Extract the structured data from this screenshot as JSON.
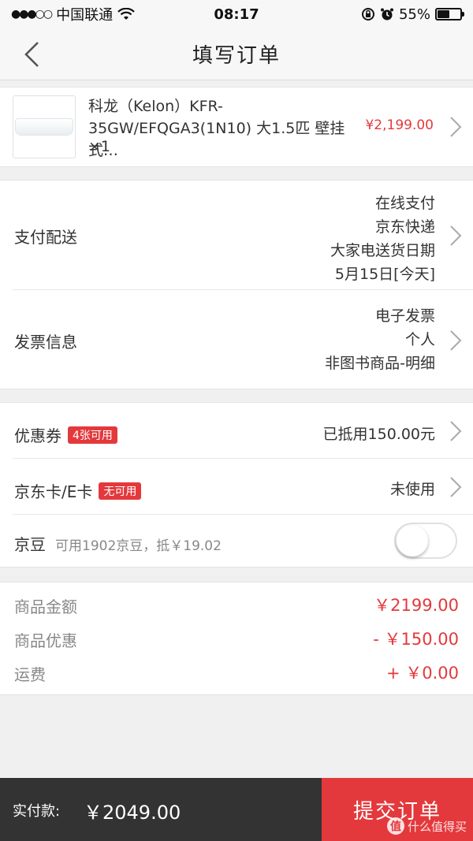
{
  "status_bar": {
    "carrier": "中国联通",
    "time": "08:17",
    "battery_percent": "55%",
    "battery_level": 0.55,
    "icons": [
      "signal-icon",
      "wifi-icon",
      "orientation-lock-icon",
      "alarm-icon",
      "battery-icon"
    ]
  },
  "nav": {
    "title": "填写订单",
    "back_icon": "chevron-left-icon"
  },
  "product": {
    "name": "科龙（Kelon）KFR-35GW/EFQGA3(1N10) 大1.5匹 壁挂式…",
    "quantity": "×1",
    "price": "¥2,199.00"
  },
  "delivery": {
    "label": "支付配送",
    "lines": [
      "在线支付",
      "京东快递",
      "大家电送货日期",
      "5月15日[今天]"
    ]
  },
  "invoice": {
    "label": "发票信息",
    "lines": [
      "电子发票",
      "个人",
      "非图书商品-明细"
    ]
  },
  "coupon": {
    "label": "优惠券",
    "tag": "4张可用",
    "value": "已抵用150.00元"
  },
  "ecard": {
    "label": "京东卡/E卡",
    "tag": "无可用",
    "value": "未使用"
  },
  "jingdou": {
    "label": "京豆",
    "sub": "可用1902京豆，抵￥19.02",
    "enabled": false
  },
  "summary": {
    "items": [
      {
        "label": "商品金额",
        "value": "￥2199.00"
      },
      {
        "label": "商品优惠",
        "value": "- ￥150.00"
      },
      {
        "label": "运费",
        "value": "+ ￥0.00"
      }
    ]
  },
  "bottom": {
    "pay_label": "实付款:",
    "pay_amount": "￥2049.00",
    "submit_label": "提交订单",
    "watermark_logo": "值",
    "watermark_text": "什么值得买"
  },
  "colors": {
    "accent": "#e4393c",
    "bottom_bar": "#333333",
    "background": "#f0f0f0"
  }
}
